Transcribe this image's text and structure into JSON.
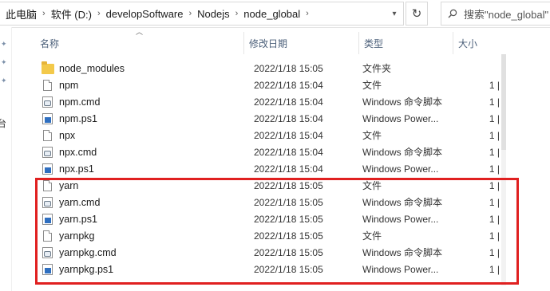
{
  "address": {
    "breadcrumbs": [
      "此电脑",
      "软件 (D:)",
      "developSoftware",
      "Nodejs",
      "node_global"
    ],
    "separator": "›"
  },
  "search": {
    "placeholder": "搜索\"node_global\""
  },
  "columns": {
    "name": "名称",
    "date": "修改日期",
    "type": "类型",
    "size": "大小"
  },
  "files": [
    {
      "name": "node_modules",
      "date": "2022/1/18 15:05",
      "type": "文件夹",
      "size": "",
      "icon": "folder-icon"
    },
    {
      "name": "npm",
      "date": "2022/1/18 15:04",
      "type": "文件",
      "size": "1 |",
      "icon": "file-icon"
    },
    {
      "name": "npm.cmd",
      "date": "2022/1/18 15:04",
      "type": "Windows 命令脚本",
      "size": "1 |",
      "icon": "cmd-script-icon"
    },
    {
      "name": "npm.ps1",
      "date": "2022/1/18 15:04",
      "type": "Windows Power...",
      "size": "1 |",
      "icon": "powershell-icon"
    },
    {
      "name": "npx",
      "date": "2022/1/18 15:04",
      "type": "文件",
      "size": "1 |",
      "icon": "file-icon"
    },
    {
      "name": "npx.cmd",
      "date": "2022/1/18 15:04",
      "type": "Windows 命令脚本",
      "size": "1 |",
      "icon": "cmd-script-icon"
    },
    {
      "name": "npx.ps1",
      "date": "2022/1/18 15:04",
      "type": "Windows Power...",
      "size": "1 |",
      "icon": "powershell-icon"
    },
    {
      "name": "yarn",
      "date": "2022/1/18 15:05",
      "type": "文件",
      "size": "1 |",
      "icon": "file-icon"
    },
    {
      "name": "yarn.cmd",
      "date": "2022/1/18 15:05",
      "type": "Windows 命令脚本",
      "size": "1 |",
      "icon": "cmd-script-icon"
    },
    {
      "name": "yarn.ps1",
      "date": "2022/1/18 15:05",
      "type": "Windows Power...",
      "size": "1 |",
      "icon": "powershell-icon"
    },
    {
      "name": "yarnpkg",
      "date": "2022/1/18 15:05",
      "type": "文件",
      "size": "1 |",
      "icon": "file-icon"
    },
    {
      "name": "yarnpkg.cmd",
      "date": "2022/1/18 15:05",
      "type": "Windows 命令脚本",
      "size": "1 |",
      "icon": "cmd-script-icon"
    },
    {
      "name": "yarnpkg.ps1",
      "date": "2022/1/18 15:05",
      "type": "Windows Power...",
      "size": "1 |",
      "icon": "powershell-icon"
    }
  ],
  "nav": {
    "partial_label": "台"
  },
  "colors": {
    "highlight": "#e02020",
    "header_text": "#4c607a"
  }
}
